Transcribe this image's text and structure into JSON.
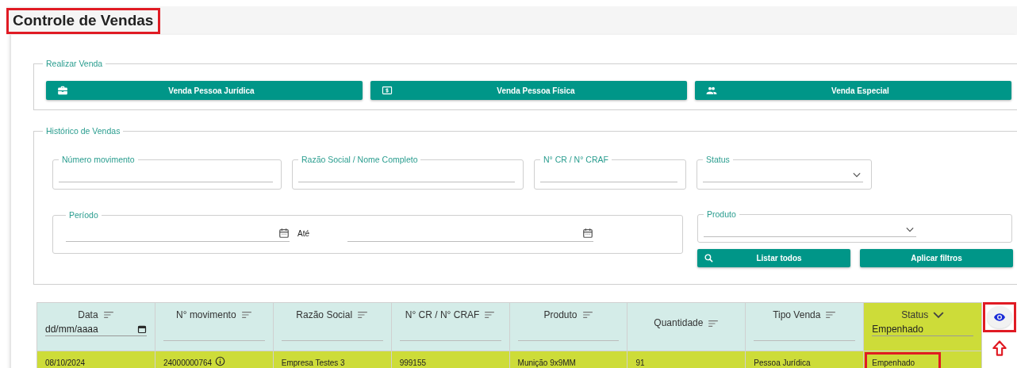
{
  "page_title": {
    "text": "Controle de Vendas",
    "annotated": true
  },
  "sale_section": {
    "legend": "Realizar Venda",
    "buttons": [
      {
        "label": "Venda Pessoa Jurídica"
      },
      {
        "label": "Venda Pessoa Física"
      },
      {
        "label": "Venda Especial"
      }
    ]
  },
  "history_section": {
    "legend": "Histórico de Vendas",
    "fields_row_1": [
      {
        "kind": "text",
        "label": "Número movimento"
      },
      {
        "kind": "text",
        "label": "Razão Social / Nome Completo"
      },
      {
        "kind": "text",
        "label": "N° CR / N° CRAF"
      },
      {
        "kind": "select",
        "label": "Status"
      }
    ],
    "period": {
      "label": "Período",
      "separator": "Até"
    },
    "product": {
      "kind": "select",
      "label": "Produto"
    },
    "buttons": [
      {
        "label": "Listar todos"
      },
      {
        "label": "Aplicar filtros"
      }
    ]
  },
  "table": {
    "columns": [
      {
        "label": "Data",
        "kind": "date",
        "placeholder": "dd/mm/aaaa",
        "highlighted": false
      },
      {
        "label": "N° movimento",
        "kind": "text",
        "highlighted": false
      },
      {
        "label": "Razão Social",
        "kind": "text",
        "highlighted": false
      },
      {
        "label": "N° CR / N° CRAF",
        "kind": "text",
        "highlighted": false
      },
      {
        "label": "Produto",
        "kind": "text",
        "highlighted": false
      },
      {
        "label": "Quantidade",
        "kind": "none",
        "highlighted": false
      },
      {
        "label": "Tipo Venda",
        "kind": "text",
        "highlighted": false
      },
      {
        "label": "Status",
        "kind": "select",
        "value": "Empenhado",
        "highlighted": true
      }
    ],
    "rows": [
      {
        "highlighted": true,
        "cells": [
          {
            "text": "08/10/2024",
            "kind": "text",
            "annotated": false
          },
          {
            "text": "24000000764",
            "kind": "info",
            "annotated": false
          },
          {
            "text": "Empresa Testes 3",
            "kind": "text",
            "annotated": false
          },
          {
            "text": "999155",
            "kind": "text",
            "annotated": false
          },
          {
            "text": "Munição 9x9MM",
            "kind": "text",
            "annotated": false
          },
          {
            "text": "91",
            "kind": "text",
            "annotated": false
          },
          {
            "text": "Pessoa Jurídica",
            "kind": "text",
            "annotated": false
          },
          {
            "text": "Empenhado",
            "kind": "text",
            "annotated": true
          }
        ]
      }
    ]
  },
  "view_button": {
    "annotated": true,
    "pointer_arrow": true
  }
}
